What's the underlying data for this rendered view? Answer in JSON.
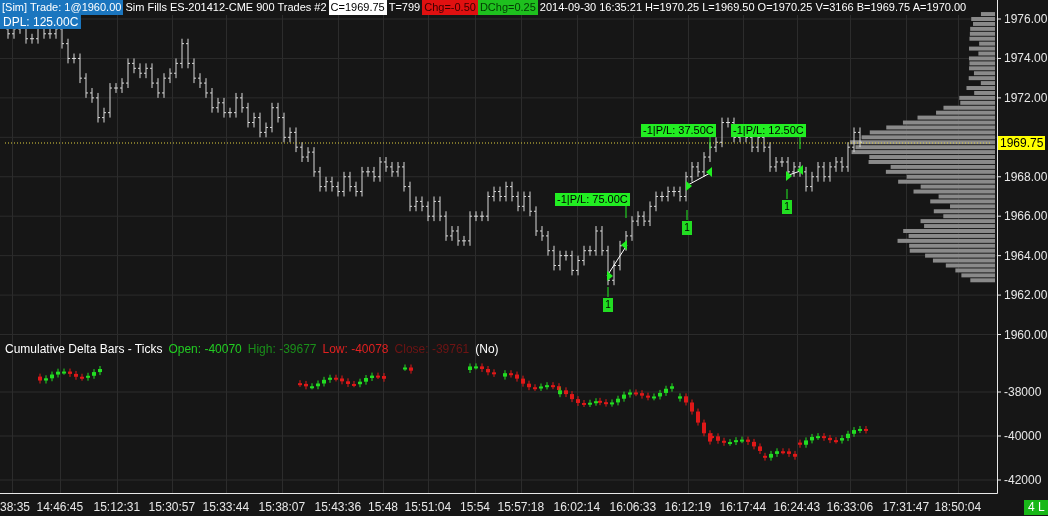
{
  "header": {
    "segments": [
      {
        "text": "[Sim]  Trade: 1@1960.00",
        "kind": "account"
      },
      {
        "text": "Sim Fills  ES-201412-CME  900 Trades  #2",
        "kind": "plain"
      },
      {
        "text": "C=1969.75",
        "kind": "close"
      },
      {
        "text": "T=799",
        "kind": "plain"
      },
      {
        "text": "Chg=-0.50",
        "kind": "change"
      },
      {
        "text": "DChg=0.25",
        "kind": "delta"
      },
      {
        "text": "2014-09-30 16:35:21 H=1970.25 L=1969.50 O=1970.25 V=3166 B=1969.75 A=1970.00",
        "kind": "plain"
      }
    ],
    "dpl": "DPL: 125.00C"
  },
  "price_axis": {
    "ticks": [
      "1976.00",
      "1974.00",
      "1972.00",
      "1968.00",
      "1966.00",
      "1964.00",
      "1962.00",
      "1960.00"
    ],
    "current_price": "1969.75"
  },
  "trades": [
    {
      "label": "-1|P/L: 75.00C",
      "fill": "1"
    },
    {
      "label": "-1|P/L: 37.50C",
      "fill": "1"
    },
    {
      "label": "-1|P/L: 12.50C",
      "fill": "1"
    }
  ],
  "indicator": {
    "title": "Cumulative Delta Bars - Ticks",
    "values": [
      {
        "text": "Open: -40070",
        "color": "#22cc22"
      },
      {
        "text": "High: -39677",
        "color": "#1a8f1a"
      },
      {
        "text": "Low: -40078",
        "color": "#e02020"
      },
      {
        "text": "Close: -39761",
        "color": "#6e1414"
      }
    ],
    "mode": "(No)",
    "ticks": [
      "-38000",
      "-40000",
      "-42000"
    ]
  },
  "time_axis": {
    "labels": [
      "38:35",
      "14:46:45",
      "15:12:31",
      "15:30:57",
      "15:33:44",
      "15:38:07",
      "15:43:36",
      "15:48",
      "15:51:04",
      "15:54",
      "15:57:18",
      "16:02:14",
      "16:06:33",
      "16:12:19",
      "16:17:44",
      "16:24:43",
      "16:33:06",
      "17:31:47",
      "18:50:04"
    ]
  },
  "status_badge": "4 L"
}
